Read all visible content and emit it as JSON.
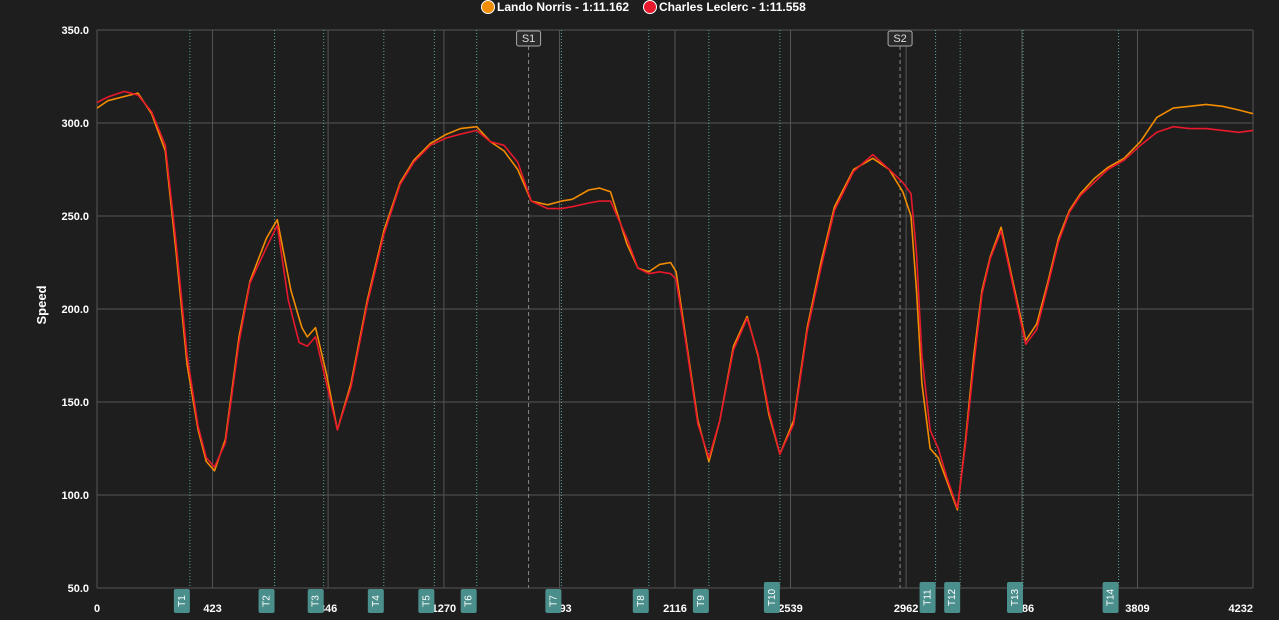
{
  "chart_data": {
    "type": "line",
    "ylabel": "Speed",
    "ylim": [
      50,
      350
    ],
    "xlim": [
      0,
      4232
    ],
    "y_ticks": [
      "350.0",
      "300.0",
      "250.0",
      "200.0",
      "150.0",
      "100.0",
      "50.0"
    ],
    "y_tick_values": [
      350,
      300,
      250,
      200,
      150,
      100,
      50
    ],
    "x_ticks": [
      {
        "value": 0,
        "label": "0"
      },
      {
        "value": 423,
        "label": "423"
      },
      {
        "value": 846,
        "label": "846"
      },
      {
        "value": 1270,
        "label": "1270"
      },
      {
        "value": 1693,
        "label": "1693"
      },
      {
        "value": 2116,
        "label": "2116"
      },
      {
        "value": 2539,
        "label": "2539"
      },
      {
        "value": 2962,
        "label": "2962"
      },
      {
        "value": 3386,
        "label": "3386"
      },
      {
        "value": 3809,
        "label": "3809"
      },
      {
        "value": 4232,
        "label": "4232"
      }
    ],
    "grid": true,
    "legend_position": "top-center",
    "series": [
      {
        "name": "Lando Norris - 1:11.162",
        "color": "#f28c00",
        "x": [
          0,
          40,
          120,
          150,
          200,
          250,
          290,
          330,
          370,
          400,
          430,
          470,
          520,
          560,
          620,
          660,
          710,
          750,
          770,
          800,
          840,
          880,
          930,
          990,
          1050,
          1110,
          1160,
          1220,
          1280,
          1330,
          1390,
          1440,
          1490,
          1540,
          1590,
          1650,
          1700,
          1740,
          1800,
          1840,
          1880,
          1940,
          1980,
          2020,
          2060,
          2100,
          2120,
          2160,
          2200,
          2240,
          2280,
          2330,
          2380,
          2420,
          2460,
          2500,
          2550,
          2600,
          2650,
          2700,
          2770,
          2840,
          2900,
          2950,
          2980,
          3000,
          3020,
          3050,
          3080,
          3110,
          3150,
          3180,
          3210,
          3240,
          3270,
          3310,
          3360,
          3400,
          3440,
          3480,
          3520,
          3560,
          3600,
          3650,
          3700,
          3760,
          3820,
          3880,
          3940,
          4000,
          4060,
          4120,
          4180,
          4232
        ],
        "values": [
          308,
          312,
          315,
          316,
          305,
          285,
          230,
          170,
          135,
          118,
          113,
          130,
          185,
          215,
          238,
          248,
          210,
          190,
          185,
          190,
          165,
          135,
          160,
          205,
          242,
          268,
          280,
          289,
          294,
          297,
          298,
          290,
          285,
          275,
          258,
          256,
          258,
          259,
          264,
          265,
          263,
          235,
          222,
          220,
          224,
          225,
          220,
          180,
          140,
          118,
          140,
          180,
          196,
          175,
          143,
          122,
          140,
          190,
          225,
          255,
          275,
          281,
          275,
          263,
          250,
          210,
          160,
          125,
          120,
          108,
          92,
          130,
          175,
          210,
          228,
          244,
          210,
          183,
          192,
          214,
          238,
          253,
          262,
          270,
          276,
          281,
          290,
          303,
          308,
          309,
          310,
          309,
          307,
          305
        ]
      },
      {
        "name": "Charles Leclerc - 1:11.558",
        "color": "#e8192c",
        "x": [
          0,
          40,
          100,
          150,
          200,
          250,
          290,
          330,
          370,
          400,
          430,
          470,
          520,
          560,
          620,
          660,
          700,
          740,
          770,
          800,
          840,
          880,
          930,
          990,
          1050,
          1110,
          1160,
          1220,
          1280,
          1330,
          1390,
          1440,
          1490,
          1540,
          1590,
          1650,
          1700,
          1740,
          1800,
          1840,
          1880,
          1940,
          1980,
          2020,
          2060,
          2100,
          2120,
          2160,
          2200,
          2240,
          2280,
          2330,
          2380,
          2420,
          2460,
          2500,
          2550,
          2600,
          2650,
          2700,
          2770,
          2840,
          2900,
          2950,
          2980,
          3000,
          3020,
          3050,
          3080,
          3110,
          3150,
          3180,
          3210,
          3240,
          3270,
          3310,
          3360,
          3400,
          3440,
          3480,
          3520,
          3560,
          3600,
          3650,
          3700,
          3760,
          3820,
          3880,
          3940,
          4000,
          4060,
          4120,
          4180,
          4232
        ],
        "values": [
          311,
          314,
          317,
          315,
          306,
          288,
          235,
          175,
          137,
          120,
          115,
          128,
          182,
          214,
          233,
          245,
          205,
          182,
          180,
          185,
          160,
          135,
          158,
          203,
          240,
          267,
          279,
          288,
          292,
          294,
          296,
          290,
          288,
          279,
          258,
          254,
          254,
          255,
          257,
          258,
          258,
          238,
          222,
          219,
          220,
          219,
          216,
          178,
          138,
          120,
          140,
          178,
          195,
          176,
          145,
          122,
          138,
          188,
          222,
          253,
          274,
          283,
          275,
          268,
          262,
          230,
          175,
          135,
          125,
          110,
          93,
          128,
          170,
          208,
          227,
          242,
          208,
          181,
          189,
          212,
          236,
          252,
          261,
          268,
          275,
          280,
          288,
          295,
          298,
          297,
          297,
          296,
          295,
          296
        ]
      }
    ],
    "sectors": [
      {
        "label": "S1",
        "x": 1580
      },
      {
        "label": "S2",
        "x": 2940
      }
    ],
    "corners": [
      {
        "label": "T1",
        "x": 340
      },
      {
        "label": "T2",
        "x": 650
      },
      {
        "label": "T3",
        "x": 830
      },
      {
        "label": "T4",
        "x": 1050
      },
      {
        "label": "T5",
        "x": 1235
      },
      {
        "label": "T6",
        "x": 1390
      },
      {
        "label": "T7",
        "x": 1700
      },
      {
        "label": "T8",
        "x": 2020
      },
      {
        "label": "T9",
        "x": 2240
      },
      {
        "label": "T10",
        "x": 2500
      },
      {
        "label": "T11",
        "x": 3070
      },
      {
        "label": "T12",
        "x": 3160
      },
      {
        "label": "T13",
        "x": 3390
      },
      {
        "label": "T14",
        "x": 3740
      }
    ],
    "colors": {
      "background": "#1e1e1e",
      "grid": "#555555",
      "corner_line": "#6cc7c0",
      "corner_badge": "#4a8f8c",
      "sector_line": "#888888"
    }
  }
}
